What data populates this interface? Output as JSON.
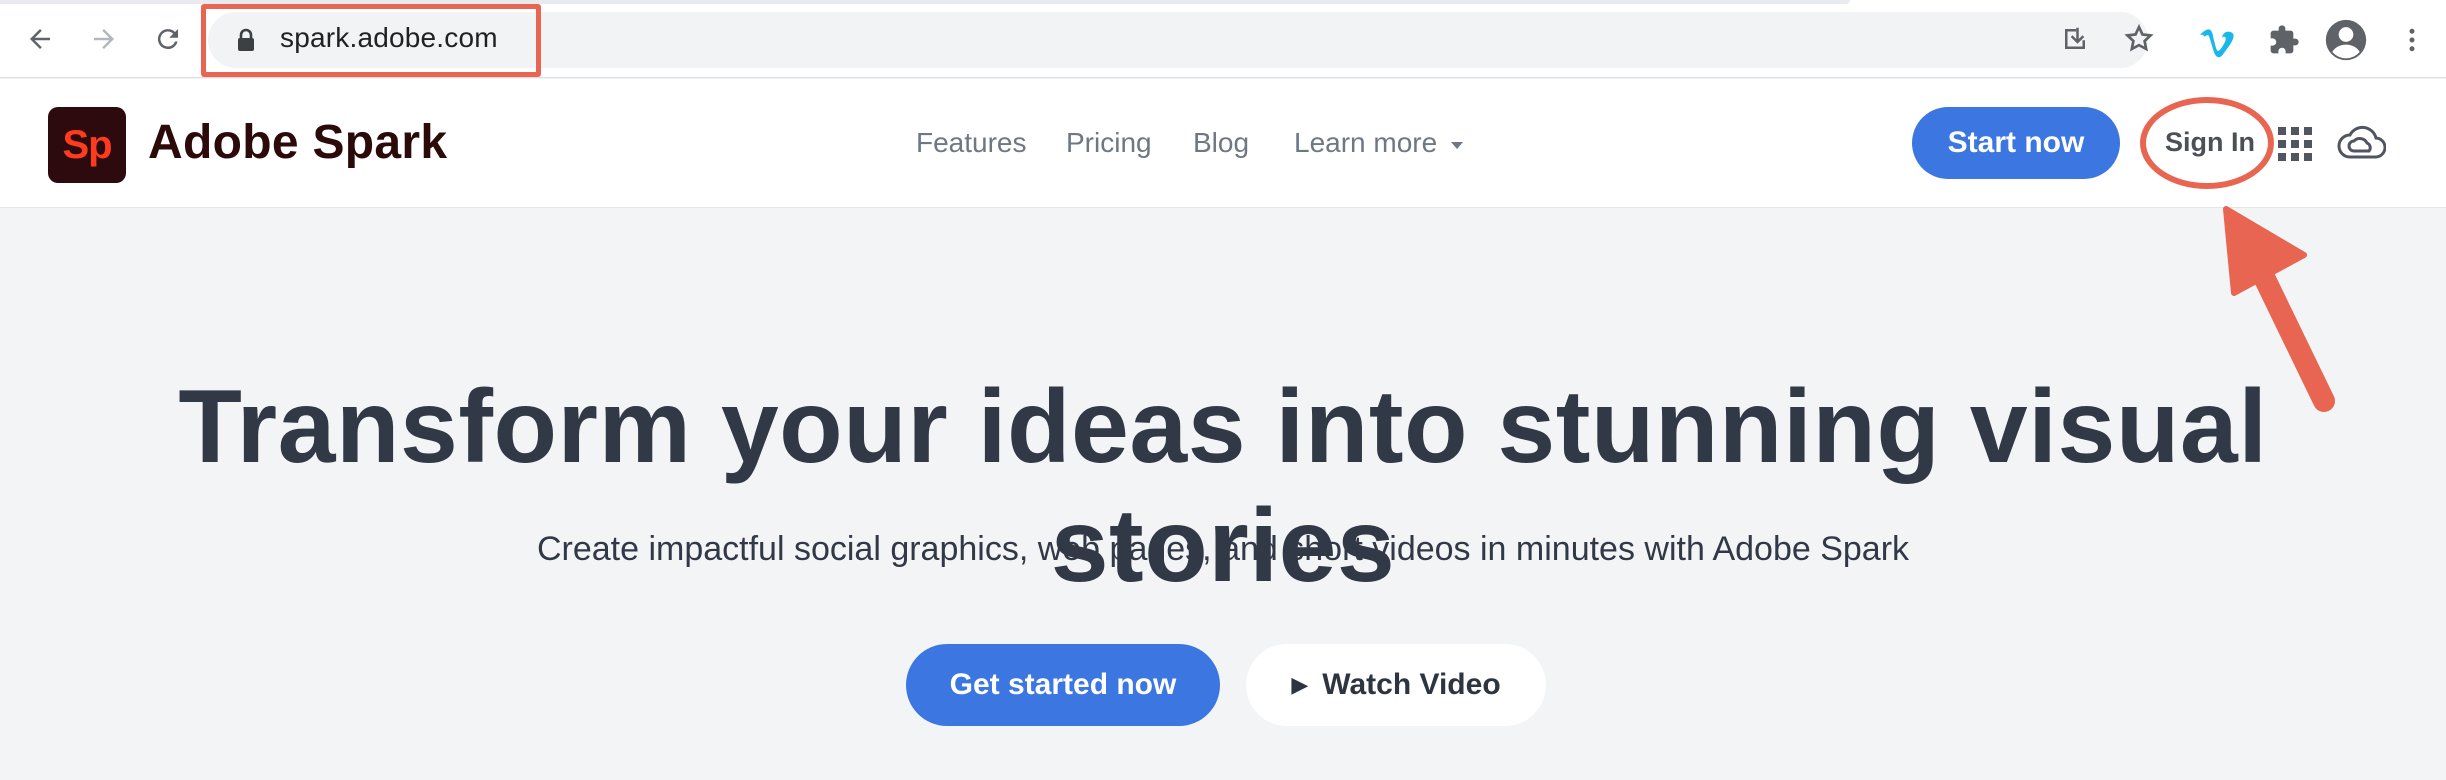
{
  "browser": {
    "url": "spark.adobe.com",
    "icons": [
      "back-icon",
      "forward-icon",
      "reload-icon",
      "lock-icon",
      "install-icon",
      "star-icon",
      "vimeo-icon",
      "extensions-icon",
      "profile-icon",
      "menu-icon"
    ]
  },
  "header": {
    "logo_text": "Sp",
    "brand": "Adobe Spark",
    "nav": [
      {
        "label": "Features"
      },
      {
        "label": "Pricing"
      },
      {
        "label": "Blog"
      },
      {
        "label": "Learn more"
      }
    ],
    "start_label": "Start now",
    "sign_in_label": "Sign In"
  },
  "hero": {
    "title": "Transform your ideas into stunning visual stories",
    "subtitle": "Create impactful social graphics, web pages, and short videos in minutes with Adobe Spark",
    "cta_primary": "Get started now",
    "cta_secondary": "Watch Video"
  },
  "colors": {
    "accent_blue": "#3b76e1",
    "annotation_red": "#e86552",
    "brand_dark": "#2c0a0a",
    "logo_red": "#ff3b1f"
  }
}
